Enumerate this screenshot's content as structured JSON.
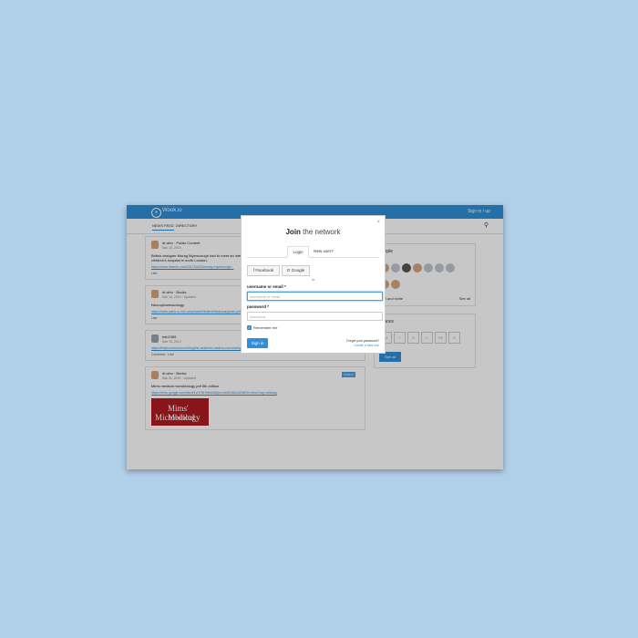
{
  "colors": {
    "accent": "#2f8fd8",
    "background": "#b0cfe8"
  },
  "topbar": {
    "logo_icon": "plus-circle-icon",
    "logo_text": "Wook.io",
    "signin": "Sign in / up"
  },
  "nav": {
    "tabs": [
      "NEWS FEED",
      "DIRECTORY"
    ],
    "search_icon": "search-icon"
  },
  "feed": {
    "posts": [
      {
        "author": "dr.who",
        "group": "Public Content",
        "date": "Mar 15, 2019",
        "text": "British designer Morag Myerscough had to meet an intensive brief: create uplifting and vibrant prints to the wards of this children's hospital in north London.",
        "link": "https://www.dezeen.com/2017/02/20/morag-myerscough...",
        "actions": "Like"
      },
      {
        "author": "dr.who",
        "group": "Books",
        "date": "Mar 15, 2019 · Updated",
        "text": "Neuropharmacology",
        "link": "https://www.wahs.ru.edu.ci/uploads/freuten/Hdukunanpulas.pdf #foundationforClinicalNeuroscience%28ed%29%5...",
        "actions": "Like"
      },
      {
        "author": "esb1989",
        "date": "Mar 15, 2019",
        "badge": "PUBLIC",
        "link": "https://thephoodsoul.com/blog/the-aesthetic-ideal-is-not-healthy/",
        "actions": "Comment · Like"
      },
      {
        "author": "dr.who",
        "group": "Books",
        "date": "Mar 11, 2019 · Updated",
        "badge": "PUBLIC",
        "text": "Mims medical microbiology pdf 5th edition",
        "link": "https://drive.google.com/file/d/1vH7NHVfkcAlf1jIzLmbDDNiaJdZWDH-/view?usp=sharing",
        "book_title_1": "Mims' Medical",
        "book_title_2": "Microbiology"
      }
    ]
  },
  "rail": {
    "people_title": "people",
    "find_invite": "Find and invite",
    "see_all": "See all",
    "spaces_title": "spaces",
    "space_letters": [
      "M",
      "T",
      "O",
      "C",
      "PA",
      "D"
    ],
    "see_all_button": "See all"
  },
  "modal": {
    "title_bold": "Join",
    "title_rest": " the network",
    "tabs": [
      "Login",
      "New user?"
    ],
    "facebook": "f  Facebook",
    "google": "G  Google",
    "or": "or",
    "username_label": "username or email *",
    "username_placeholder": "username or email",
    "password_label": "password *",
    "password_placeholder": "password",
    "remember": "Remember me",
    "signin": "Sign in",
    "forgot": "Forgot your password?",
    "create": "Create a new one",
    "close_icon": "close-icon"
  }
}
